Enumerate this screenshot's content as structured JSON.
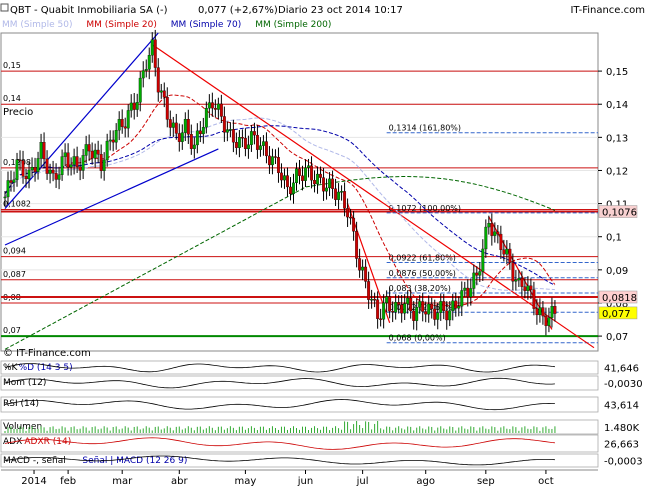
{
  "header": {
    "symbol_title": "QBT - Quabit Inmobiliaria SA (-)",
    "last_change": "0,077 (+2,67%)",
    "period_time": "Diario  23 oct 2014 10:17",
    "brand": "IT-Finance.com",
    "legend": [
      {
        "label": "MM (Simple 50)",
        "color": "#b0b8e8"
      },
      {
        "label": "MM (Simple 20)",
        "color": "#cc0000"
      },
      {
        "label": "MM (Simple 70)",
        "color": "#0000aa"
      },
      {
        "label": "MM (Simple 200)",
        "color": "#006600"
      }
    ]
  },
  "price_label": "Precio",
  "copyright": "© IT-Finance.com",
  "colors": {
    "up": "#00aa00",
    "down": "#cc0000",
    "channel": "#0000cc",
    "trend": "#ee0000",
    "fib": "#3366cc",
    "support": "#008800",
    "price_badge": "#ffff00",
    "badge_1076": "#f8d0d0",
    "badge_0818": "#ffd0d0"
  },
  "chart_data": {
    "type": "candlestick",
    "ylim": [
      0.0655,
      0.1615
    ],
    "y_ticks": [
      "0,15",
      "0,14",
      "0,13",
      "0,12",
      "0,11",
      "0,1",
      "0,09",
      "0,08",
      "0,07"
    ],
    "y_tick_values": [
      0.15,
      0.14,
      0.13,
      0.12,
      0.11,
      0.1,
      0.09,
      0.08,
      0.07
    ],
    "x_labels": [
      "2014",
      "feb",
      "mar",
      "abr",
      "may",
      "jun",
      "jul",
      "ago",
      "sep",
      "oct"
    ],
    "left_levels": [
      {
        "label": "0,15",
        "value": 0.15
      },
      {
        "label": "0,14",
        "value": 0.14
      },
      {
        "label": "0,1208",
        "value": 0.1208
      },
      {
        "label": "0,1082",
        "value": 0.1082
      },
      {
        "label": "0,094",
        "value": 0.094
      },
      {
        "label": "0,087",
        "value": 0.087
      },
      {
        "label": "0,08",
        "value": 0.08
      },
      {
        "label": "0,07",
        "value": 0.07
      }
    ],
    "right_badges": [
      {
        "label": "0,1076",
        "value": 0.1076
      },
      {
        "label": "0,0818",
        "value": 0.0818
      },
      {
        "label": "0,077",
        "value": 0.077
      }
    ],
    "fibonacci": [
      {
        "label": "0,1314 (161,80%)",
        "value": 0.1314
      },
      {
        "label": "0,1072 (100,00%)",
        "value": 0.1072
      },
      {
        "label": "0,0922 (61,80%)",
        "value": 0.0922
      },
      {
        "label": "0,0876 (50,00%)",
        "value": 0.0876
      },
      {
        "label": "0,083 (38,20%)",
        "value": 0.083
      },
      {
        "label": "0,0772 (23,60%)",
        "value": 0.0772
      },
      {
        "label": "0,068 (0,00%)",
        "value": 0.068
      }
    ],
    "close_path": [
      [
        0,
        0.112
      ],
      [
        4,
        0.122
      ],
      [
        8,
        0.118
      ],
      [
        12,
        0.126
      ],
      [
        16,
        0.117
      ],
      [
        20,
        0.124
      ],
      [
        24,
        0.121
      ],
      [
        28,
        0.127
      ],
      [
        32,
        0.122
      ],
      [
        36,
        0.131
      ],
      [
        40,
        0.135
      ],
      [
        44,
        0.142
      ],
      [
        47,
        0.153
      ],
      [
        49,
        0.157
      ],
      [
        51,
        0.146
      ],
      [
        54,
        0.137
      ],
      [
        57,
        0.13
      ],
      [
        60,
        0.133
      ],
      [
        63,
        0.127
      ],
      [
        66,
        0.135
      ],
      [
        69,
        0.141
      ],
      [
        72,
        0.136
      ],
      [
        75,
        0.13
      ],
      [
        79,
        0.128
      ],
      [
        83,
        0.13
      ],
      [
        87,
        0.125
      ],
      [
        91,
        0.121
      ],
      [
        94,
        0.114
      ],
      [
        97,
        0.118
      ],
      [
        100,
        0.12
      ],
      [
        104,
        0.117
      ],
      [
        108,
        0.115
      ],
      [
        111,
        0.113
      ],
      [
        114,
        0.108
      ],
      [
        116,
        0.1
      ],
      [
        118,
        0.091
      ],
      [
        120,
        0.086
      ],
      [
        122,
        0.081
      ],
      [
        124,
        0.076
      ],
      [
        127,
        0.08
      ],
      [
        130,
        0.078
      ],
      [
        133,
        0.08
      ],
      [
        136,
        0.077
      ],
      [
        139,
        0.079
      ],
      [
        142,
        0.077
      ],
      [
        145,
        0.078
      ],
      [
        148,
        0.077
      ],
      [
        151,
        0.081
      ],
      [
        154,
        0.084
      ],
      [
        157,
        0.088
      ],
      [
        159,
        0.096
      ],
      [
        161,
        0.105
      ],
      [
        163,
        0.1
      ],
      [
        165,
        0.098
      ],
      [
        167,
        0.094
      ],
      [
        169,
        0.089
      ],
      [
        171,
        0.085
      ],
      [
        173,
        0.086
      ],
      [
        175,
        0.082
      ],
      [
        177,
        0.078
      ],
      [
        179,
        0.075
      ],
      [
        181,
        0.076
      ],
      [
        183,
        0.077
      ]
    ],
    "indicators": [
      {
        "name": "%K",
        "params": "%D (14 3 5)",
        "value": "41,646"
      },
      {
        "name": "Mom (12)",
        "value": "-0,0030"
      },
      {
        "name": "RSI (14)",
        "value": "43,614"
      },
      {
        "name": "Volumen",
        "value": "1.480K"
      },
      {
        "name": "ADX",
        "params": "ADXR (14)",
        "value": "26,663"
      },
      {
        "name": "MACD -, señal",
        "params": "Señal | MACD (12 26 9)",
        "value": "-0,0003"
      }
    ]
  }
}
